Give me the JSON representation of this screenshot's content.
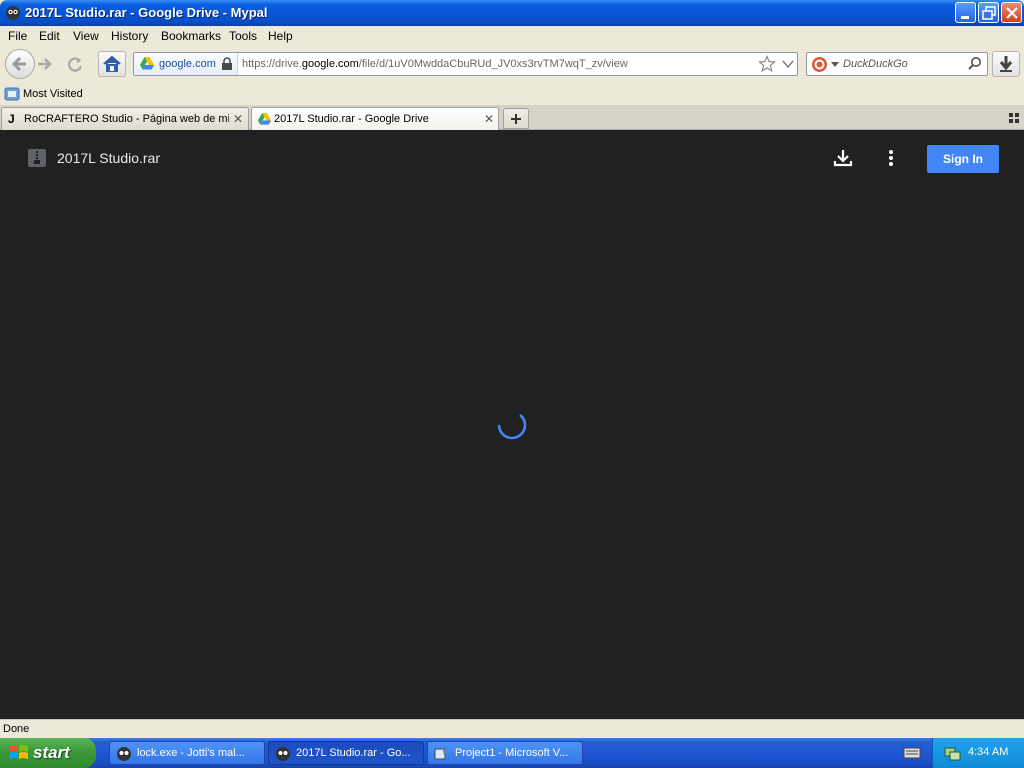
{
  "window": {
    "title": "2017L Studio.rar - Google Drive - Mypal"
  },
  "menu": [
    "File",
    "Edit",
    "View",
    "History",
    "Bookmarks",
    "Tools",
    "Help"
  ],
  "nav": {
    "identity_domain": "google.com",
    "url_prefix": "https://drive.",
    "url_domain": "google.com",
    "url_suffix": "/file/d/1uV0MwddaCbuRUd_JV0xs3rvTM7wqT_zv/view",
    "search_placeholder": "DuckDuckGo"
  },
  "bookmarks": {
    "most_visited": "Most Visited"
  },
  "tabs": [
    {
      "label": "RoCRAFTERO Studio - Página web de mi...",
      "icon": "j-icon",
      "active": false
    },
    {
      "label": "2017L Studio.rar - Google Drive",
      "icon": "google-drive-icon",
      "active": true
    }
  ],
  "drive": {
    "file_name": "2017L Studio.rar",
    "sign_in_label": "Sign In"
  },
  "status": {
    "text": "Done"
  },
  "taskbar": {
    "start_label": "start",
    "tasks": [
      {
        "label": "lock.exe - Jotti's mal...",
        "active": false
      },
      {
        "label": "2017L Studio.rar - Go...",
        "active": true
      },
      {
        "label": "Project1 - Microsoft V...",
        "active": false
      }
    ],
    "clock": "4:34 AM"
  },
  "colors": {
    "content_bg": "#212121",
    "sign_in_bg": "#4285f4",
    "spinner": "#4285f4",
    "titlebar": "#0655d6"
  }
}
